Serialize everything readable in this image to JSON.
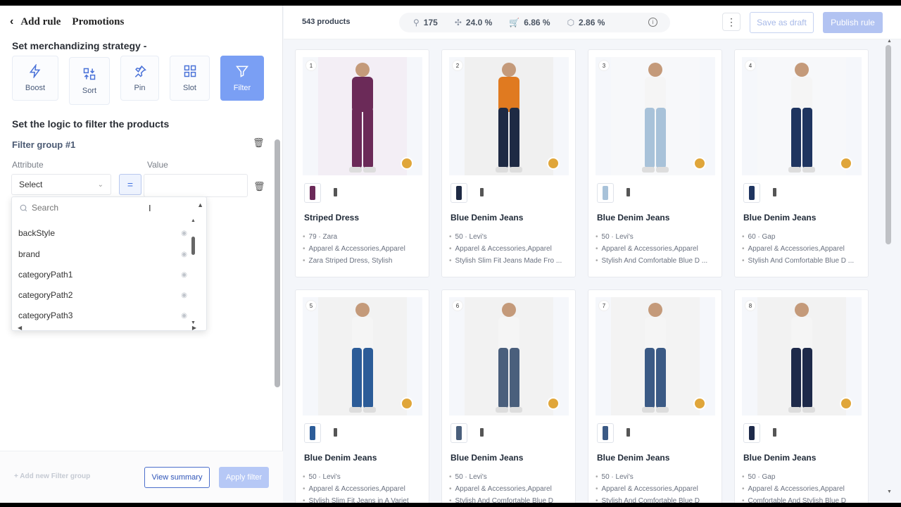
{
  "header": {
    "back_label": "Add rule",
    "breadcrumb": "Promotions"
  },
  "strategy": {
    "title": "Set merchandizing strategy -",
    "options": [
      {
        "label": "Boost",
        "icon": "boost-icon"
      },
      {
        "label": "Sort",
        "icon": "sort-icon"
      },
      {
        "label": "Pin",
        "icon": "pin-icon"
      },
      {
        "label": "Slot",
        "icon": "slot-icon"
      },
      {
        "label": "Filter",
        "icon": "filter-icon",
        "selected": true
      }
    ]
  },
  "filter": {
    "logic_title": "Set the logic to filter the products",
    "group_title": "Filter group #1",
    "attribute_label": "Attribute",
    "value_label": "Value",
    "select_value": "Select",
    "operator": "=",
    "search_placeholder": "Search",
    "options": [
      "backStyle",
      "brand",
      "categoryPath1",
      "categoryPath2",
      "categoryPath3"
    ]
  },
  "footer": {
    "add_group": "+ Add new Filter group",
    "view_summary": "View summary",
    "apply_filter": "Apply filter"
  },
  "topbar": {
    "product_count": "543 products",
    "stats": [
      {
        "icon": "search-icon",
        "value": "175"
      },
      {
        "icon": "click-icon",
        "value": "24.0 %"
      },
      {
        "icon": "cart-icon",
        "value": "6.86 %"
      },
      {
        "icon": "box-icon",
        "value": "2.86 %"
      }
    ],
    "save_draft": "Save as draft",
    "publish": "Publish rule"
  },
  "products": [
    {
      "num": "1",
      "name": "Striped Dress",
      "m1": "79 · Zara",
      "m2": "Apparel & Accessories,Apparel",
      "m3": "Zara Striped Dress, Stylish"
    },
    {
      "num": "2",
      "name": "Blue Denim Jeans",
      "m1": "50 · Levi's",
      "m2": "Apparel & Accessories,Apparel",
      "m3": "Stylish Slim Fit Jeans Made Fro ..."
    },
    {
      "num": "3",
      "name": "Blue Denim Jeans",
      "m1": "50 · Levi's",
      "m2": "Apparel & Accessories,Apparel",
      "m3": "Stylish And Comfortable Blue D ..."
    },
    {
      "num": "4",
      "name": "Blue Denim Jeans",
      "m1": "60 · Gap",
      "m2": "Apparel & Accessories,Apparel",
      "m3": "Stylish And Comfortable Blue D ..."
    },
    {
      "num": "5",
      "name": "Blue Denim Jeans",
      "m1": "50 · Levi's",
      "m2": "Apparel & Accessories,Apparel",
      "m3": "Stylish Slim Fit Jeans in A Variet"
    },
    {
      "num": "6",
      "name": "Blue Denim Jeans",
      "m1": "50 · Levi's",
      "m2": "Apparel & Accessories,Apparel",
      "m3": "Stylish And Comfortable Blue D"
    },
    {
      "num": "7",
      "name": "Blue Denim Jeans",
      "m1": "50 · Levi's",
      "m2": "Apparel & Accessories,Apparel",
      "m3": "Stylish And Comfortable Blue D"
    },
    {
      "num": "8",
      "name": "Blue Denim Jeans",
      "m1": "50 · Gap",
      "m2": "Apparel & Accessories,Apparel",
      "m3": "Comfortable And Stylish Blue D"
    }
  ],
  "colors": {
    "accent": "#7a9ff4",
    "badge": "#e0a63a",
    "button_outline": "#4c6fcc"
  }
}
